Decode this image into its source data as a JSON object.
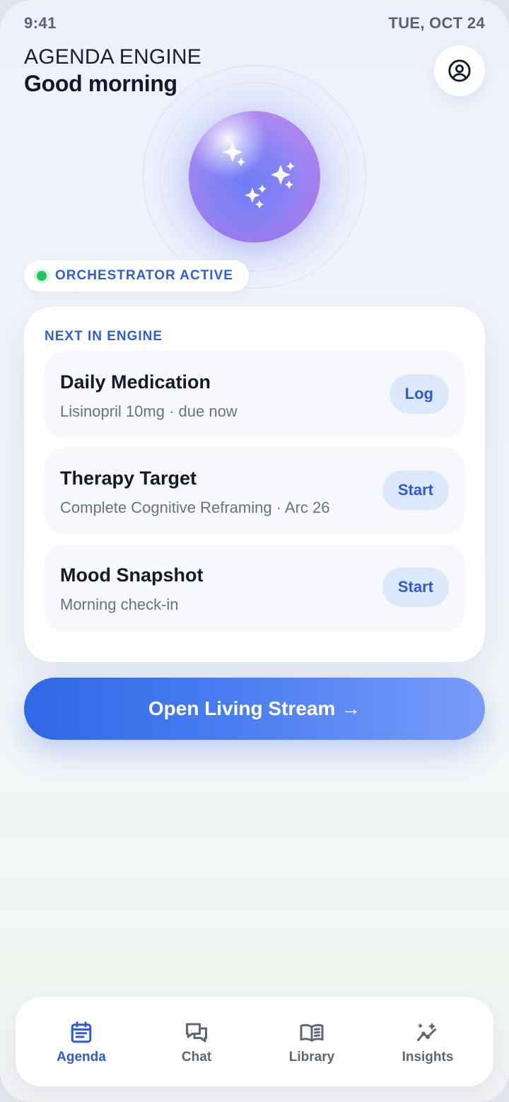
{
  "status_bar": {
    "time": "9:41",
    "date": "TUE, OCT 24"
  },
  "header": {
    "app_title": "AGENDA ENGINE",
    "greeting": "Good morning",
    "profile_icon": "user-circle-icon"
  },
  "orb": {
    "icon": "sparkles-icon"
  },
  "orchestrator": {
    "status": "ORCHESTRATOR ACTIVE",
    "status_color": "#22c55e"
  },
  "next_section": {
    "label": "NEXT IN ENGINE",
    "tasks": [
      {
        "title": "Daily Medication",
        "subtitle": "Lisinopril 10mg · due now",
        "action": "Log"
      },
      {
        "title": "Therapy Target",
        "subtitle": "Complete Cognitive Reframing · Arc 26",
        "action": "Start"
      },
      {
        "title": "Mood Snapshot",
        "subtitle": "Morning check-in",
        "action": "Start"
      }
    ]
  },
  "cta": {
    "label": "Open Living Stream →"
  },
  "nav": {
    "active": "Agenda",
    "accent": "#2e5bd3",
    "items": [
      {
        "label": "Agenda",
        "icon": "calendar-list-icon"
      },
      {
        "label": "Chat",
        "icon": "chat-bubbles-icon"
      },
      {
        "label": "Library",
        "icon": "open-book-icon"
      },
      {
        "label": "Insights",
        "icon": "sparkle-trend-icon"
      }
    ]
  }
}
